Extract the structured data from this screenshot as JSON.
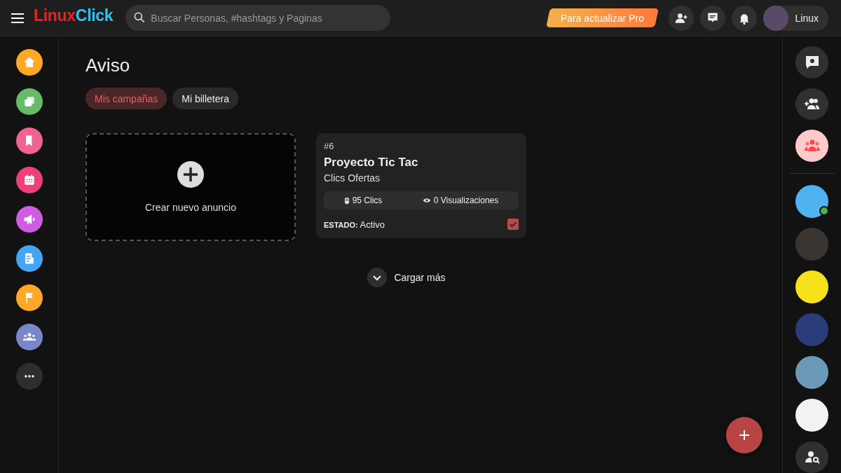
{
  "header": {
    "logo": {
      "first": "Linux",
      "second": "Click"
    },
    "search": {
      "placeholder": "Buscar Personas, #hashtags y Paginas"
    },
    "upgrade_button": "Para actualizar Pro",
    "user": {
      "name": "Linux"
    }
  },
  "left_nav": [
    {
      "kind": "home",
      "color": "#ffa726"
    },
    {
      "kind": "pages",
      "color": "#66bb6a"
    },
    {
      "kind": "bookmark",
      "color": "#f06292"
    },
    {
      "kind": "calendar",
      "color": "#ec407a"
    },
    {
      "kind": "megaphone",
      "color": "#d05ce3"
    },
    {
      "kind": "news",
      "color": "#42a5f5"
    },
    {
      "kind": "flag",
      "color": "#ffa726"
    },
    {
      "kind": "groups",
      "color": "#7986cb"
    },
    {
      "kind": "more",
      "color": "#2e2e2e"
    }
  ],
  "page": {
    "title": "Aviso",
    "tabs": [
      {
        "label": "Mis campañas",
        "selected": true
      },
      {
        "label": "Mi billetera",
        "selected": false
      }
    ],
    "create_card": {
      "label": "Crear nuevo anuncio"
    },
    "campaigns": [
      {
        "number": "#6",
        "title": "Proyecto Tic Tac",
        "type": "Clics Ofertas",
        "clicks": "95 Clics",
        "views": "0 Visualizaciones",
        "status": "**ESTADO:** Activo",
        "active": true
      }
    ],
    "load_more": "Cargar más"
  },
  "right_sidebar": {
    "actions": [
      {
        "kind": "chat-settings"
      },
      {
        "kind": "add-people"
      },
      {
        "kind": "groups"
      }
    ],
    "contacts": [
      {
        "color": "#4fb3f0",
        "online": true
      },
      {
        "color": "#3a3530",
        "online": false
      },
      {
        "color": "#f5e21a",
        "online": false
      },
      {
        "color": "#2a3d7a",
        "online": false
      },
      {
        "color": "#6a9ab8",
        "online": false
      },
      {
        "color": "#f2f2f2",
        "online": false
      }
    ]
  }
}
